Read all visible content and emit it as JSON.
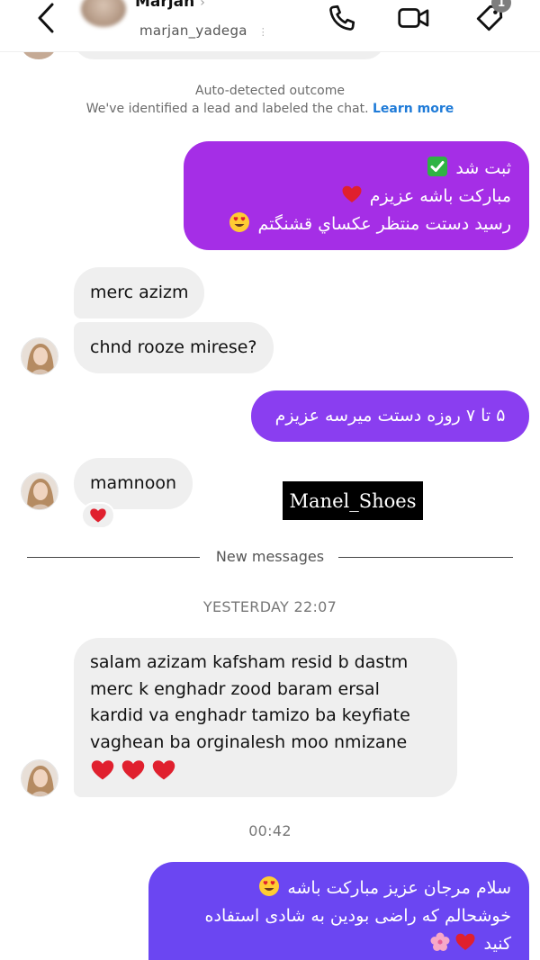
{
  "header": {
    "name": "Marjan",
    "handle": "marjan_yadega",
    "chevron": "›",
    "dots": "⋮",
    "tag_badge": "1"
  },
  "notice": {
    "title": "Auto-detected outcome",
    "text": "We've identified a lead and labeled the chat.",
    "link": "Learn more"
  },
  "messages": [
    {
      "id": "m1",
      "direction": "out",
      "lines": [
        "ثبت شد",
        "مبارکت باشه عزیزم",
        "رسید دستت منتظر عکساي قشنگتم"
      ],
      "emojis": [
        "check-emoji",
        "heart-emoji",
        "heart-eyes-emoji"
      ]
    },
    {
      "id": "m2",
      "direction": "in",
      "text": "merc azizm"
    },
    {
      "id": "m3",
      "direction": "in",
      "text": "chnd rooze mirese?"
    },
    {
      "id": "m4",
      "direction": "out",
      "text": "۵ تا ۷ روزه دستت میرسه عزیزم"
    },
    {
      "id": "m5",
      "direction": "in",
      "text": "mamnoon",
      "reaction": "heart-emoji"
    },
    {
      "id": "m6",
      "direction": "in",
      "lines": [
        "salam azizam kafsham resid b dastm",
        "merc k enghadr zood baram ersal",
        "kardid va enghadr tamizo ba keyfiate",
        "vaghean ba orginalesh moo nmizane"
      ],
      "emojis": [
        "heart-emoji",
        "heart-emoji",
        "heart-emoji"
      ]
    },
    {
      "id": "m7",
      "direction": "out",
      "lines": [
        "سلام مرجان عزیز مبارکت باشه",
        "خوشحالم که راضی بودین به شادی استفاده",
        "کنید"
      ],
      "emojis": [
        "heart-eyes-emoji",
        "heart-emoji",
        "cherry-blossom-emoji"
      ]
    }
  ],
  "divider": {
    "label": "New messages"
  },
  "timestamps": {
    "first": "YESTERDAY 22:07",
    "second": "00:42"
  },
  "watermark": "Manel_Shoes",
  "colors": {
    "bubble_out_1": "#a52ee6",
    "bubble_out_2": "#8a3ef0",
    "bubble_out_3": "#6b46f2",
    "bubble_in": "#efefef",
    "link": "#1f7bd8"
  }
}
